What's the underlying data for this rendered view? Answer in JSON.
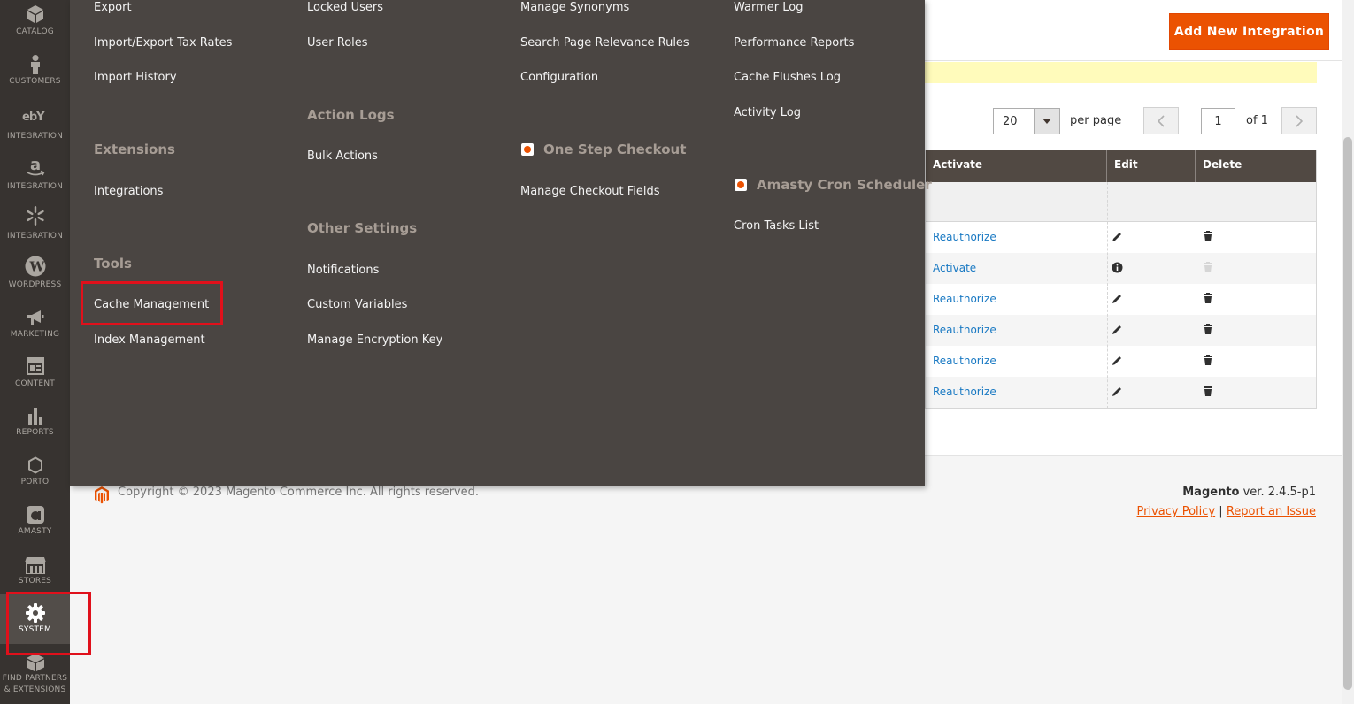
{
  "sidebar": {
    "items": [
      {
        "label": "CATALOG",
        "icon": "catalog-icon"
      },
      {
        "label": "CUSTOMERS",
        "icon": "customers-icon"
      },
      {
        "label": "INTEGRATION",
        "icon": "ebay-icon"
      },
      {
        "label": "INTEGRATION",
        "icon": "amazon-icon"
      },
      {
        "label": "INTEGRATION",
        "icon": "walmart-icon"
      },
      {
        "label": "WORDPRESS",
        "icon": "wordpress-icon"
      },
      {
        "label": "MARKETING",
        "icon": "megaphone-icon"
      },
      {
        "label": "CONTENT",
        "icon": "content-icon"
      },
      {
        "label": "REPORTS",
        "icon": "reports-icon"
      },
      {
        "label": "PORTO",
        "icon": "hexagon-icon"
      },
      {
        "label": "AMASTY",
        "icon": "amasty-icon"
      },
      {
        "label": "STORES",
        "icon": "stores-icon"
      },
      {
        "label": "SYSTEM",
        "icon": "gear-icon"
      },
      {
        "label_line1": "FIND PARTNERS",
        "label_line2": "& EXTENSIONS",
        "icon": "box-icon"
      }
    ]
  },
  "flyout": {
    "col1": {
      "items_top": [
        "Export",
        "Import/Export Tax Rates",
        "Import History"
      ],
      "extensions_heading": "Extensions",
      "extensions_items": [
        "Integrations"
      ],
      "tools_heading": "Tools",
      "tools_items": [
        "Cache Management",
        "Index Management"
      ]
    },
    "col2": {
      "items_top": [
        "Locked Users",
        "User Roles"
      ],
      "action_logs_heading": "Action Logs",
      "action_logs_items": [
        "Bulk Actions"
      ],
      "other_heading": "Other Settings",
      "other_items": [
        "Notifications",
        "Custom Variables",
        "Manage Encryption Key"
      ]
    },
    "col3": {
      "items_top": [
        "Manage Synonyms",
        "Search Page Relevance Rules",
        "Configuration"
      ],
      "osc_heading": "One Step Checkout",
      "osc_items": [
        "Manage Checkout Fields"
      ]
    },
    "col4": {
      "items_top": [
        "Warmer Log",
        "Performance Reports",
        "Cache Flushes Log",
        "Activity Log"
      ],
      "cron_heading": "Amasty Cron Scheduler",
      "cron_items": [
        "Cron Tasks List"
      ]
    }
  },
  "header": {
    "add_button": "Add New Integration"
  },
  "pager": {
    "per_page_value": "20",
    "per_page_label": "per page",
    "page_value": "1",
    "of_label": "of 1"
  },
  "grid": {
    "columns": [
      "Activate",
      "Edit",
      "Delete"
    ],
    "rows": [
      {
        "activate": "Reauthorize",
        "edit": "pencil",
        "delete": "trash"
      },
      {
        "activate": "Activate",
        "edit": "info",
        "delete": "trash-disabled"
      },
      {
        "activate": "Reauthorize",
        "edit": "pencil",
        "delete": "trash"
      },
      {
        "activate": "Reauthorize",
        "edit": "pencil",
        "delete": "trash"
      },
      {
        "activate": "Reauthorize",
        "edit": "pencil",
        "delete": "trash"
      },
      {
        "activate": "Reauthorize",
        "edit": "pencil",
        "delete": "trash"
      }
    ]
  },
  "footer": {
    "copyright": "Copyright © 2023 Magento Commerce Inc. All rights reserved.",
    "brand": "Magento",
    "version": " ver. 2.4.5-p1",
    "privacy": "Privacy Policy",
    "separator": "|",
    "report": "Report an Issue"
  },
  "colors": {
    "accent": "#eb5202",
    "menu_bg": "#4a4542",
    "sidebar_bg": "#373330",
    "highlight": "#e0101b",
    "link": "#1979c3"
  }
}
